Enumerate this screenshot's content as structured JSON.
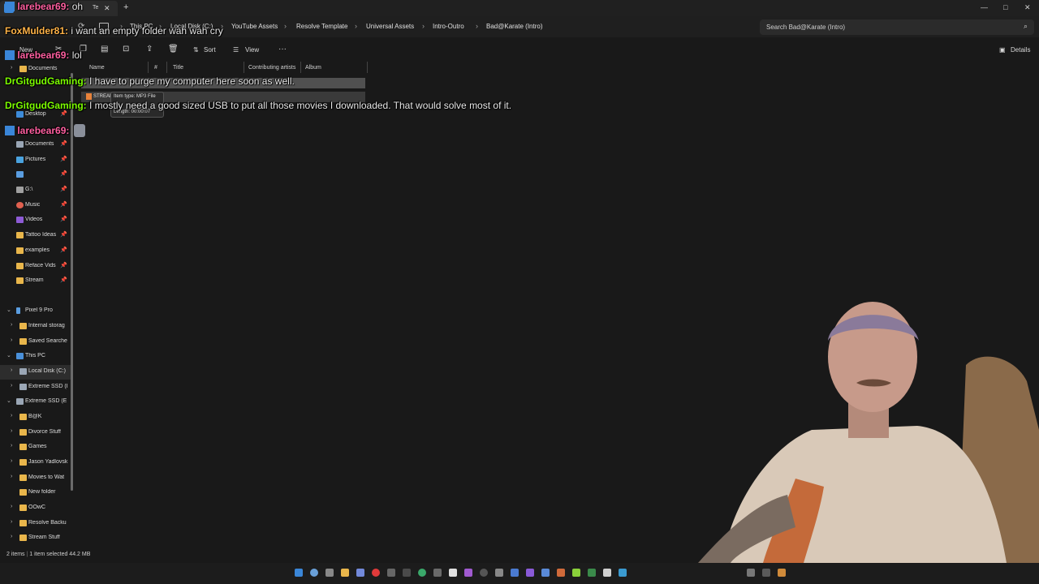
{
  "window": {
    "tab_label": "Te",
    "tab_close": "✕",
    "new_tab": "+",
    "minimize": "—",
    "maximize": "□",
    "close": "✕"
  },
  "breadcrumb": {
    "items": [
      "This PC",
      "Local Disk (C:)",
      "YouTube Assets",
      "Resolve Template",
      "Universal Assets",
      "Intro-Outro",
      "Bad@Karate (Intro)"
    ],
    "separator": "›"
  },
  "search": {
    "placeholder": "Search Bad@Karate (Intro)",
    "icon": "search-icon"
  },
  "toolbar": {
    "new_label": "New",
    "sort_label": "Sort",
    "view_label": "View",
    "more_label": "···",
    "details_label": "Details"
  },
  "columns": [
    "Name",
    "#",
    "Title",
    "Contributing artists",
    "Album"
  ],
  "files": [
    {
      "name": "STREAM",
      "tooltip_type": "Item type: MP3 File",
      "tooltip_length": "Length: 00:00:07"
    }
  ],
  "sidebar": {
    "quick_access": [
      {
        "label": "Documents",
        "icon": "folder-icon"
      },
      {
        "label": "Desktop",
        "icon": "desktop-icon",
        "pinned": true
      },
      {
        "label": "Documents",
        "icon": "documents-icon",
        "pinned": true
      },
      {
        "label": "Pictures",
        "icon": "pictures-icon",
        "pinned": true
      },
      {
        "label": "",
        "icon": "drive-icon",
        "pinned": true
      },
      {
        "label": "G:\\",
        "icon": "drive-icon",
        "pinned": true
      },
      {
        "label": "Music",
        "icon": "music-icon",
        "pinned": true
      },
      {
        "label": "Videos",
        "icon": "videos-icon",
        "pinned": true
      },
      {
        "label": "Tattoo Ideas",
        "icon": "folder-icon",
        "pinned": true
      },
      {
        "label": "examples",
        "icon": "folder-icon",
        "pinned": true
      },
      {
        "label": "Reface Vids",
        "icon": "folder-icon",
        "pinned": true
      },
      {
        "label": "Stream",
        "icon": "folder-icon",
        "pinned": true
      }
    ],
    "tree": [
      {
        "label": "Pixel 9 Pro",
        "level": 0,
        "expanded": true
      },
      {
        "label": "Internal storag",
        "level": 1
      },
      {
        "label": "Saved Searche",
        "level": 1
      },
      {
        "label": "This PC",
        "level": 0,
        "expanded": true
      },
      {
        "label": "Local Disk (C:)",
        "level": 1,
        "selected": true
      },
      {
        "label": "Extreme SSD (I",
        "level": 1
      },
      {
        "label": "Extreme SSD (E:)",
        "level": 0,
        "expanded": true
      },
      {
        "label": "B@K",
        "level": 1
      },
      {
        "label": "Divorce Stuff",
        "level": 1
      },
      {
        "label": "Games",
        "level": 1
      },
      {
        "label": "Jason Yadlovsk",
        "level": 1
      },
      {
        "label": "Movies to Wat",
        "level": 1
      },
      {
        "label": "New folder",
        "level": 1
      },
      {
        "label": "OOwC",
        "level": 1
      },
      {
        "label": "Resolve Backu",
        "level": 1
      },
      {
        "label": "Stream Stuff",
        "level": 1
      }
    ]
  },
  "status": {
    "items": "2 items",
    "selected": "1 item selected  44.2 MB"
  },
  "chat": [
    {
      "user": "larebear69",
      "text": "oh"
    },
    {
      "user": "FoxMulder81",
      "text": "i want an empty folder wah wah cry"
    },
    {
      "user": "larebear69",
      "text": "lol"
    },
    {
      "user": "DrGitgudGaming",
      "text": "I have to purge my computer here soon as well."
    },
    {
      "user": "DrGitgudGaming",
      "text": "I mostly need a good sized USB to put all those movies I downloaded. That would solve most of it."
    },
    {
      "user": "larebear69",
      "text": ""
    }
  ],
  "colors": {
    "accent": "#3a86d8",
    "folder": "#e9b64b",
    "chat_pink": "#ff5fa0",
    "chat_orange": "#ffb347",
    "chat_green": "#7cfc00"
  }
}
